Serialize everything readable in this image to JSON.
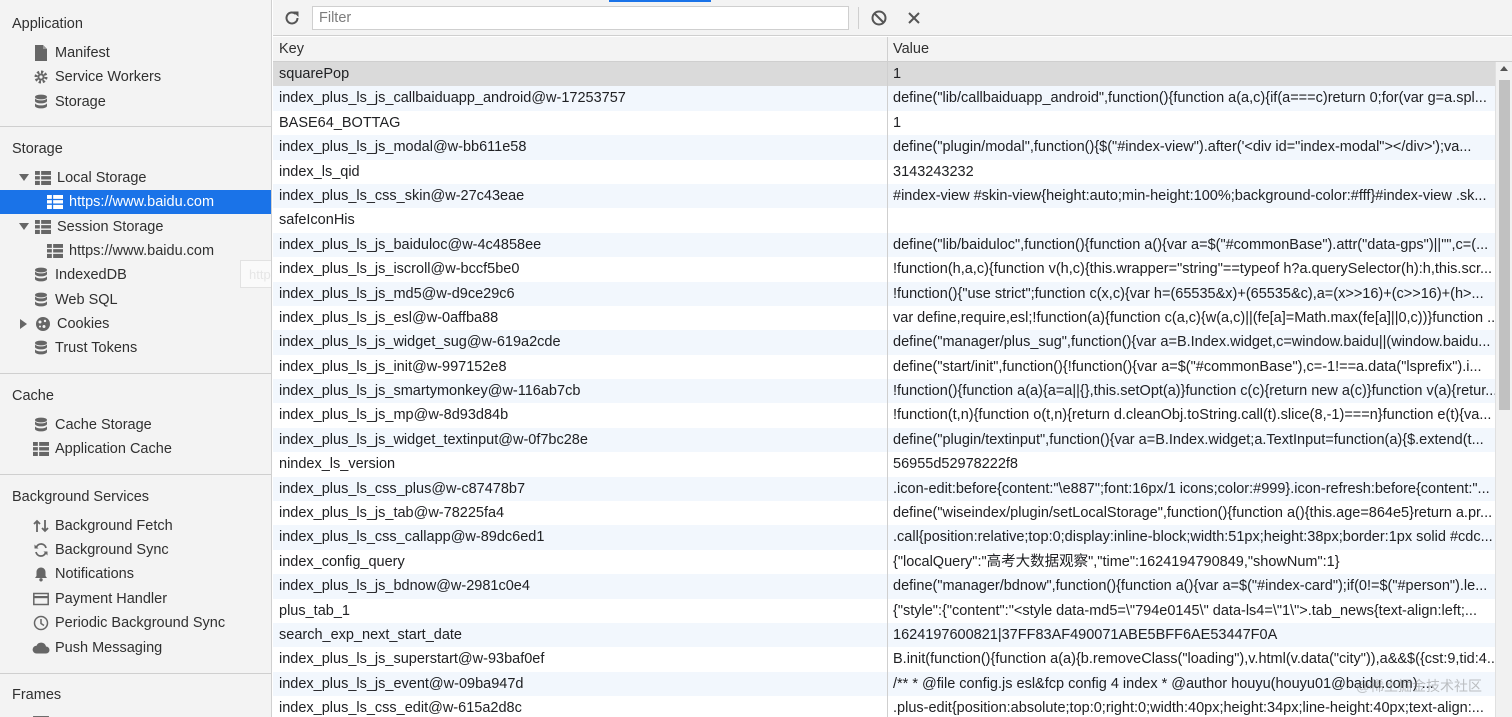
{
  "sidebar": {
    "application": {
      "title": "Application",
      "items": [
        {
          "label": "Manifest",
          "icon": "document-icon"
        },
        {
          "label": "Service Workers",
          "icon": "gear-icon"
        },
        {
          "label": "Storage",
          "icon": "database-icon"
        }
      ]
    },
    "storage": {
      "title": "Storage",
      "local_storage": "Local Storage",
      "local_origin": "https://www.baidu.com",
      "session_storage": "Session Storage",
      "session_origin": "https://www.baidu.com",
      "indexeddb": "IndexedDB",
      "websql": "Web SQL",
      "cookies": "Cookies",
      "trust_tokens": "Trust Tokens"
    },
    "cache": {
      "title": "Cache",
      "cache_storage": "Cache Storage",
      "application_cache": "Application Cache"
    },
    "background_services": {
      "title": "Background Services",
      "items": [
        {
          "label": "Background Fetch",
          "icon": "fetch-arrows-icon"
        },
        {
          "label": "Background Sync",
          "icon": "sync-icon"
        },
        {
          "label": "Notifications",
          "icon": "bell-icon"
        },
        {
          "label": "Payment Handler",
          "icon": "card-icon"
        },
        {
          "label": "Periodic Background Sync",
          "icon": "clock-icon"
        },
        {
          "label": "Push Messaging",
          "icon": "cloud-icon"
        }
      ]
    },
    "frames": {
      "title": "Frames"
    },
    "ghost_text": "http"
  },
  "toolbar": {
    "filter_placeholder": "Filter",
    "accent": "#1a73e8"
  },
  "table": {
    "columns": {
      "key": "Key",
      "value": "Value"
    },
    "rows": [
      {
        "key": "squarePop",
        "value": "1"
      },
      {
        "key": "index_plus_ls_js_callbaiduapp_android@w-17253757",
        "value": "define(\"lib/callbaiduapp_android\",function(){function a(a,c){if(a===c)return 0;for(var g=a.spl..."
      },
      {
        "key": "BASE64_BOTTAG",
        "value": "1"
      },
      {
        "key": "index_plus_ls_js_modal@w-bb611e58",
        "value": "define(\"plugin/modal\",function(){$(\"#index-view\").after('<div id=\"index-modal\"></div>');va..."
      },
      {
        "key": "index_ls_qid",
        "value": "3143243232"
      },
      {
        "key": "index_plus_ls_css_skin@w-27c43eae",
        "value": "#index-view #skin-view{height:auto;min-height:100%;background-color:#fff}#index-view .sk..."
      },
      {
        "key": "safeIconHis",
        "value": ""
      },
      {
        "key": "index_plus_ls_js_baiduloc@w-4c4858ee",
        "value": "define(\"lib/baiduloc\",function(){function a(){var a=$(\"#commonBase\").attr(\"data-gps\")||\"\",c=(..."
      },
      {
        "key": "index_plus_ls_js_iscroll@w-bccf5be0",
        "value": "!function(h,a,c){function v(h,c){this.wrapper=\"string\"==typeof h?a.querySelector(h):h,this.scr..."
      },
      {
        "key": "index_plus_ls_js_md5@w-d9ce29c6",
        "value": "!function(){\"use strict\";function c(x,c){var h=(65535&x)+(65535&c),a=(x>>16)+(c>>16)+(h>..."
      },
      {
        "key": "index_plus_ls_js_esl@w-0affba88",
        "value": "var define,require,esl;!function(a){function c(a,c){w(a,c)||(fe[a]=Math.max(fe[a]||0,c))}function ..."
      },
      {
        "key": "index_plus_ls_js_widget_sug@w-619a2cde",
        "value": "define(\"manager/plus_sug\",function(){var a=B.Index.widget,c=window.baidu||(window.baidu..."
      },
      {
        "key": "index_plus_ls_js_init@w-997152e8",
        "value": "define(\"start/init\",function(){!function(){var a=$(\"#commonBase\"),c=-1!==a.data(\"lsprefix\").i..."
      },
      {
        "key": "index_plus_ls_js_smartymonkey@w-116ab7cb",
        "value": "!function(){function a(a){a=a||{},this.setOpt(a)}function c(c){return new a(c)}function v(a){retur..."
      },
      {
        "key": "index_plus_ls_js_mp@w-8d93d84b",
        "value": "!function(t,n){function o(t,n){return d.cleanObj.toString.call(t).slice(8,-1)===n}function e(t){va..."
      },
      {
        "key": "index_plus_ls_js_widget_textinput@w-0f7bc28e",
        "value": "define(\"plugin/textinput\",function(){var a=B.Index.widget;a.TextInput=function(a){$.extend(t..."
      },
      {
        "key": "nindex_ls_version",
        "value": "56955d52978222f8"
      },
      {
        "key": "index_plus_ls_css_plus@w-c87478b7",
        "value": ".icon-edit:before{content:\"\\e887\";font:16px/1 icons;color:#999}.icon-refresh:before{content:\"..."
      },
      {
        "key": "index_plus_ls_js_tab@w-78225fa4",
        "value": "define(\"wiseindex/plugin/setLocalStorage\",function(){function a(){this.age=864e5}return a.pr..."
      },
      {
        "key": "index_plus_ls_css_callapp@w-89dc6ed1",
        "value": ".call{position:relative;top:0;display:inline-block;width:51px;height:38px;border:1px solid #cdc..."
      },
      {
        "key": "index_config_query",
        "value": "{\"localQuery\":\"高考大数据观察\",\"time\":1624194790849,\"showNum\":1}"
      },
      {
        "key": "index_plus_ls_js_bdnow@w-2981c0e4",
        "value": "define(\"manager/bdnow\",function(){function a(){var a=$(\"#index-card\");if(0!=$(\"#person\").le..."
      },
      {
        "key": "plus_tab_1",
        "value": "{\"style\":{\"content\":\"<style data-md5=\\\"794e0145\\\" data-ls4=\\\"1\\\">.tab_news{text-align:left;..."
      },
      {
        "key": "search_exp_next_start_date",
        "value": "1624197600821|37FF83AF490071ABE5BFF6AE53447F0A"
      },
      {
        "key": "index_plus_ls_js_superstart@w-93baf0ef",
        "value": "B.init(function(){function a(a){b.removeClass(\"loading\"),v.html(v.data(\"city\")),a&&$({cst:9,tid:4..."
      },
      {
        "key": "index_plus_ls_js_event@w-09ba947d",
        "value": "/** * @file config.js esl&fcp config 4 index * @author houyu(houyu01@baidu.com) ..."
      },
      {
        "key": "index_plus_ls_css_edit@w-615a2d8c",
        "value": ".plus-edit{position:absolute;top:0;right:0;width:40px;height:34px;line-height:40px;text-align:..."
      }
    ]
  },
  "watermark": "@稀土掘金技术社区"
}
